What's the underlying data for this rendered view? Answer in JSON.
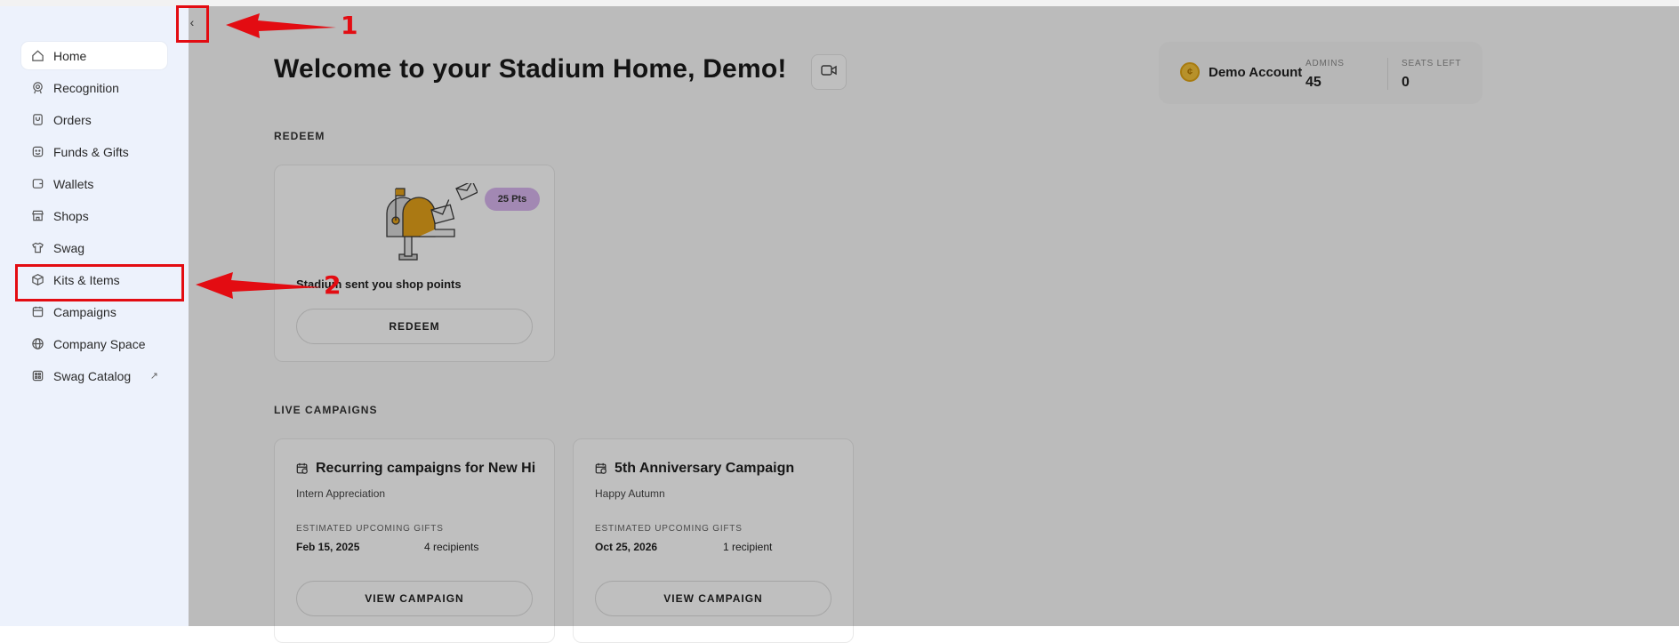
{
  "sidebar": {
    "collapse_glyph": "‹",
    "items": [
      {
        "label": "Home",
        "icon": "home-icon"
      },
      {
        "label": "Recognition",
        "icon": "award-icon"
      },
      {
        "label": "Orders",
        "icon": "bag-icon"
      },
      {
        "label": "Funds & Gifts",
        "icon": "gift-icon"
      },
      {
        "label": "Wallets",
        "icon": "wallet-icon"
      },
      {
        "label": "Shops",
        "icon": "store-icon"
      },
      {
        "label": "Swag",
        "icon": "shirt-icon"
      },
      {
        "label": "Kits & Items",
        "icon": "box-icon"
      },
      {
        "label": "Campaigns",
        "icon": "calendar-icon"
      },
      {
        "label": "Company Space",
        "icon": "globe-icon"
      },
      {
        "label": "Swag Catalog",
        "icon": "catalog-icon",
        "external_glyph": "↗"
      }
    ]
  },
  "header": {
    "title": "Welcome to your Stadium Home, Demo!"
  },
  "account": {
    "name": "Demo Account",
    "admins_label": "ADMINS",
    "admins_value": "45",
    "seats_label": "SEATS LEFT",
    "seats_value": "0"
  },
  "redeem": {
    "section_label": "REDEEM",
    "points_badge": "25 Pts",
    "message": "Stadium sent you shop points",
    "button_label": "REDEEM"
  },
  "live_campaigns": {
    "section_label": "LIVE CAMPAIGNS",
    "cards": [
      {
        "title": "Recurring campaigns for New Hi",
        "subtitle": "Intern Appreciation",
        "est_label": "ESTIMATED UPCOMING GIFTS",
        "date": "Feb 15, 2025",
        "recipients": "4 recipients",
        "button_label": "VIEW CAMPAIGN"
      },
      {
        "title": "5th Anniversary Campaign",
        "subtitle": "Happy Autumn",
        "est_label": "ESTIMATED UPCOMING GIFTS",
        "date": "Oct 25, 2026",
        "recipients": "1 recipient",
        "button_label": "VIEW CAMPAIGN"
      }
    ]
  },
  "annotations": {
    "marker_1": "1",
    "marker_2": "2",
    "color": "#e30c12"
  }
}
